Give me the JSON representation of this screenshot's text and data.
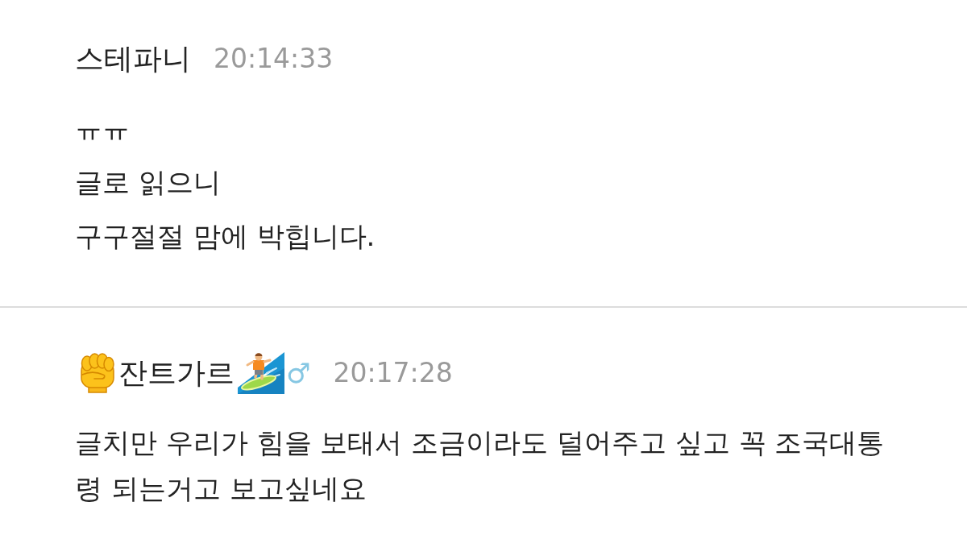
{
  "comments": [
    {
      "author": [
        {
          "kind": "text",
          "text": "스테파니"
        }
      ],
      "time": "20:14:33",
      "paragraphs": [
        "ㅠㅠ",
        "글로 읽으니",
        "구구절절 맘에 박힙니다."
      ]
    },
    {
      "author": [
        {
          "kind": "fist"
        },
        {
          "kind": "text",
          "text": "잔트가르"
        },
        {
          "kind": "surfer"
        },
        {
          "kind": "sign",
          "text": "♂"
        }
      ],
      "time": "20:17:28",
      "paragraphs": [
        "글치만 우리가 힘을 보태서 조금이라도 덜어주고 싶고 꼭 조국대통령 되는거고 보고싶네요"
      ]
    }
  ]
}
